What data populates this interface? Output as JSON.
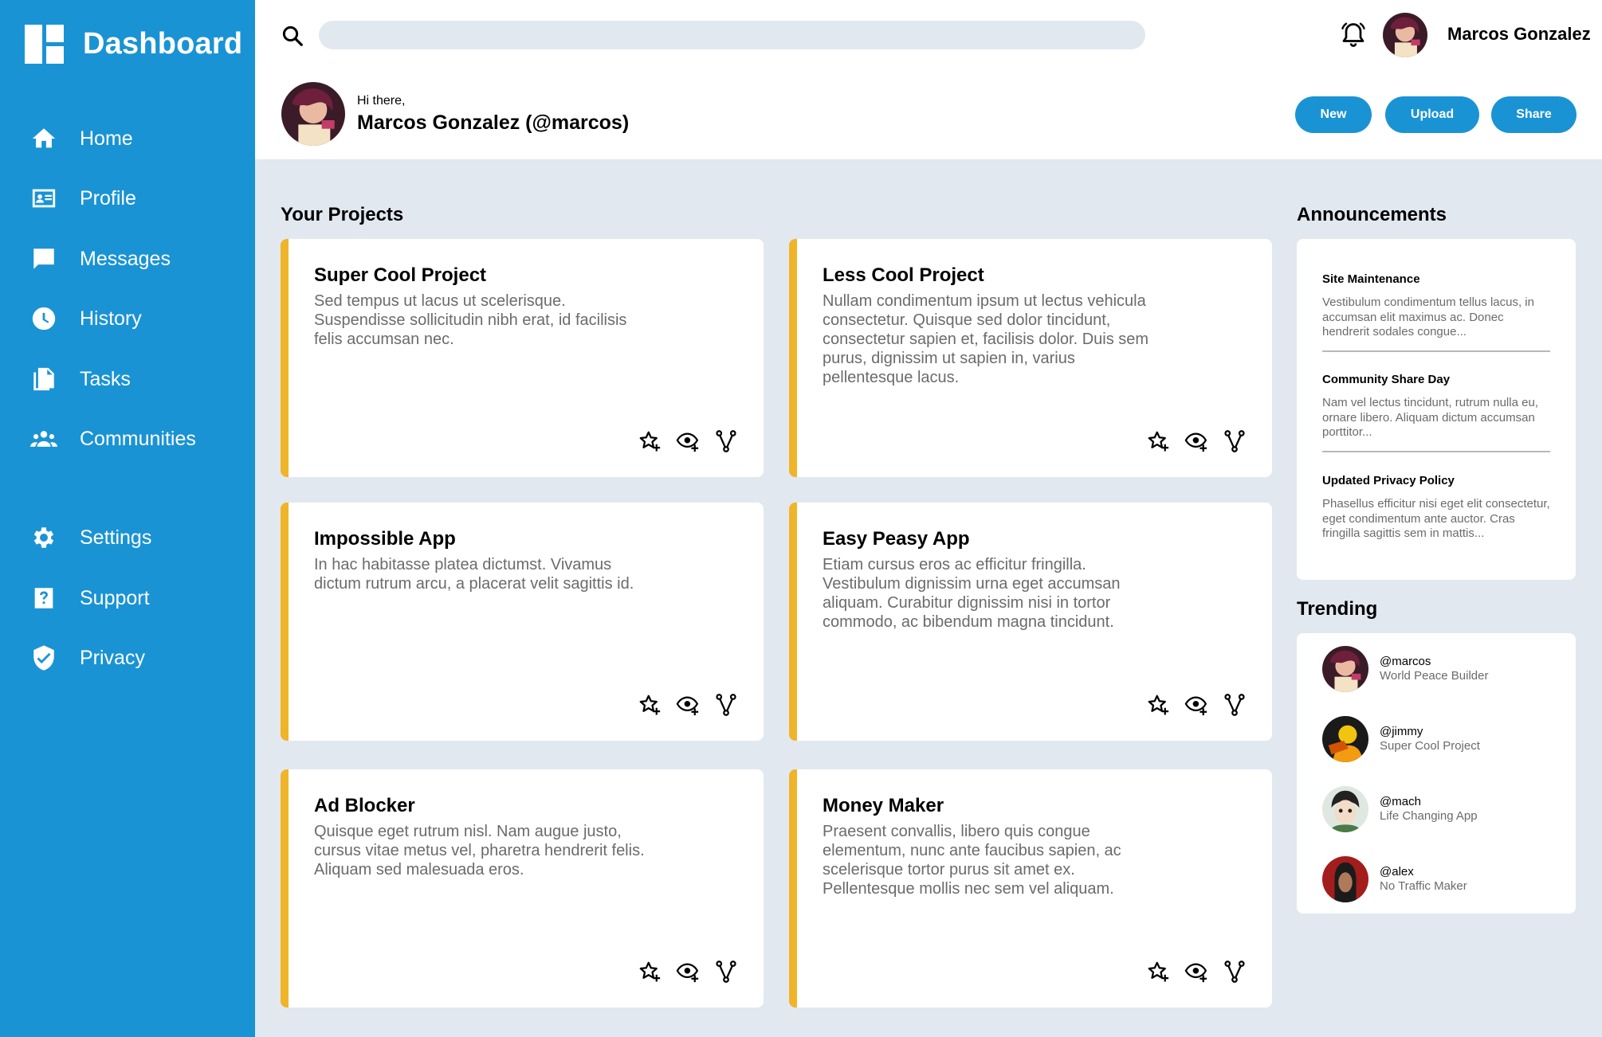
{
  "brand": {
    "title": "Dashboard"
  },
  "sidebar": {
    "items": [
      {
        "label": "Home",
        "icon": "home-icon"
      },
      {
        "label": "Profile",
        "icon": "id-card-icon"
      },
      {
        "label": "Messages",
        "icon": "message-icon"
      },
      {
        "label": "History",
        "icon": "clock-icon"
      },
      {
        "label": "Tasks",
        "icon": "documents-icon"
      },
      {
        "label": "Communities",
        "icon": "group-icon"
      },
      {
        "label": "Settings",
        "icon": "gear-icon"
      },
      {
        "label": "Support",
        "icon": "help-icon"
      },
      {
        "label": "Privacy",
        "icon": "shield-icon"
      }
    ]
  },
  "header": {
    "search_placeholder": "",
    "username": "Marcos Gonzalez",
    "greeting": "Hi there,",
    "full_name": "Marcos Gonzalez (@marcos)",
    "buttons": {
      "new": "New",
      "upload": "Upload",
      "share": "Share"
    }
  },
  "projects": {
    "title": "Your Projects",
    "items": [
      {
        "title": "Super Cool Project",
        "description": "Sed tempus ut lacus ut scelerisque. Suspendisse sollicitudin nibh erat, id facilisis felis accumsan nec."
      },
      {
        "title": "Less Cool Project",
        "description": "Nullam condimentum ipsum ut lectus vehicula consectetur. Quisque sed dolor tincidunt, consectetur sapien et, facilisis dolor. Duis sem purus, dignissim ut sapien in, varius pellentesque lacus."
      },
      {
        "title": "Impossible App",
        "description": "In hac habitasse platea dictumst. Vivamus dictum rutrum arcu, a placerat velit sagittis id."
      },
      {
        "title": "Easy Peasy App",
        "description": "Etiam cursus eros ac efficitur fringilla. Vestibulum dignissim urna eget accumsan aliquam. Curabitur dignissim nisi in tortor commodo, ac bibendum magna tincidunt."
      },
      {
        "title": "Ad Blocker",
        "description": "Quisque eget rutrum nisl. Nam augue justo, cursus vitae metus vel, pharetra hendrerit felis. Aliquam sed malesuada eros."
      },
      {
        "title": "Money Maker",
        "description": "Praesent convallis, libero quis congue elementum, nunc ante faucibus sapien, ac scelerisque tortor purus sit amet ex. Pellentesque mollis nec sem vel aliquam."
      }
    ]
  },
  "announcements": {
    "title": "Announcements",
    "items": [
      {
        "title": "Site Maintenance",
        "body": "Vestibulum condimentum tellus lacus, in accumsan elit maximus ac. Donec hendrerit sodales congue..."
      },
      {
        "title": "Community Share Day",
        "body": "Nam vel lectus tincidunt, rutrum nulla eu, ornare libero. Aliquam dictum accumsan porttitor..."
      },
      {
        "title": "Updated Privacy Policy",
        "body": "Phasellus efficitur nisi eget elit consectetur, eget condimentum ante auctor. Cras fringilla sagittis sem in mattis..."
      }
    ]
  },
  "trending": {
    "title": "Trending",
    "items": [
      {
        "handle": "@marcos",
        "subtitle": "World Peace Builder"
      },
      {
        "handle": "@jimmy",
        "subtitle": "Super Cool Project"
      },
      {
        "handle": "@mach",
        "subtitle": "Life Changing App"
      },
      {
        "handle": "@alex",
        "subtitle": "No Traffic Maker"
      }
    ]
  },
  "colors": {
    "sidebar": "#1a93d4",
    "accent": "#f0b429",
    "background": "#e2e8f0",
    "button": "#1a93d4"
  }
}
